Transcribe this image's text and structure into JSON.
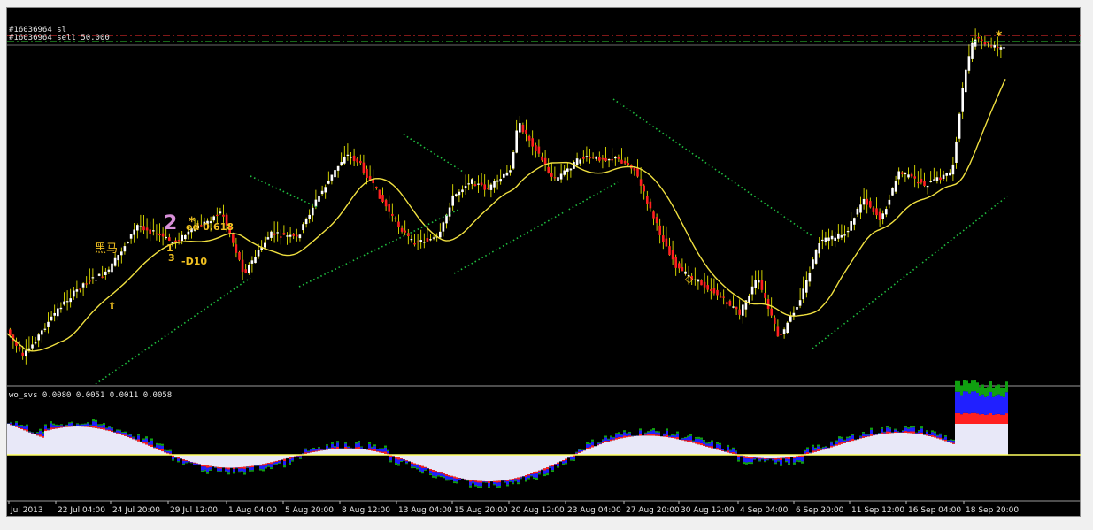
{
  "trade_lines": {
    "sl_label": "#16036964 sl",
    "sell_label": "#16036964 sell 50.000",
    "sl_color": "#ff3030",
    "sell_color": "#30d030"
  },
  "indicator": {
    "label": "wo_svs 0.0080 0.0051 0.0011 0.0058"
  },
  "annotations": [
    {
      "id": "num-2",
      "text": "2"
    },
    {
      "id": "star",
      "text": "*"
    },
    {
      "id": "ed-618",
      "text": "ed 0.618"
    },
    {
      "id": "num-1",
      "text": "1"
    },
    {
      "id": "num-3",
      "text": "3"
    },
    {
      "id": "d10",
      "text": "-D10"
    },
    {
      "id": "cjk",
      "text": "黑马"
    },
    {
      "id": "star2",
      "text": "*"
    }
  ],
  "x_axis": {
    "labels": [
      "Jul 2013",
      "22 Jul 04:00",
      "24 Jul 20:00",
      "29 Jul 12:00",
      "1 Aug 04:00",
      "5 Aug 20:00",
      "8 Aug 12:00",
      "13 Aug 04:00",
      "15 Aug 20:00",
      "20 Aug 12:00",
      "23 Aug 04:00",
      "27 Aug 20:00",
      "30 Aug 12:00",
      "4 Sep 04:00",
      "6 Sep 20:00",
      "11 Sep 12:00",
      "16 Sep 04:00",
      "18 Sep 20:00"
    ]
  },
  "colors": {
    "bull": "#ffffff",
    "bear": "#ff2020",
    "wick": "#ffff00",
    "ma": "#f0e040",
    "dots": "#20c040",
    "zero": "#ffff60",
    "osc_base": "#e8e8f8",
    "osc_red": "#ff2020",
    "osc_blue": "#2020ff",
    "osc_green": "#10a010"
  }
}
